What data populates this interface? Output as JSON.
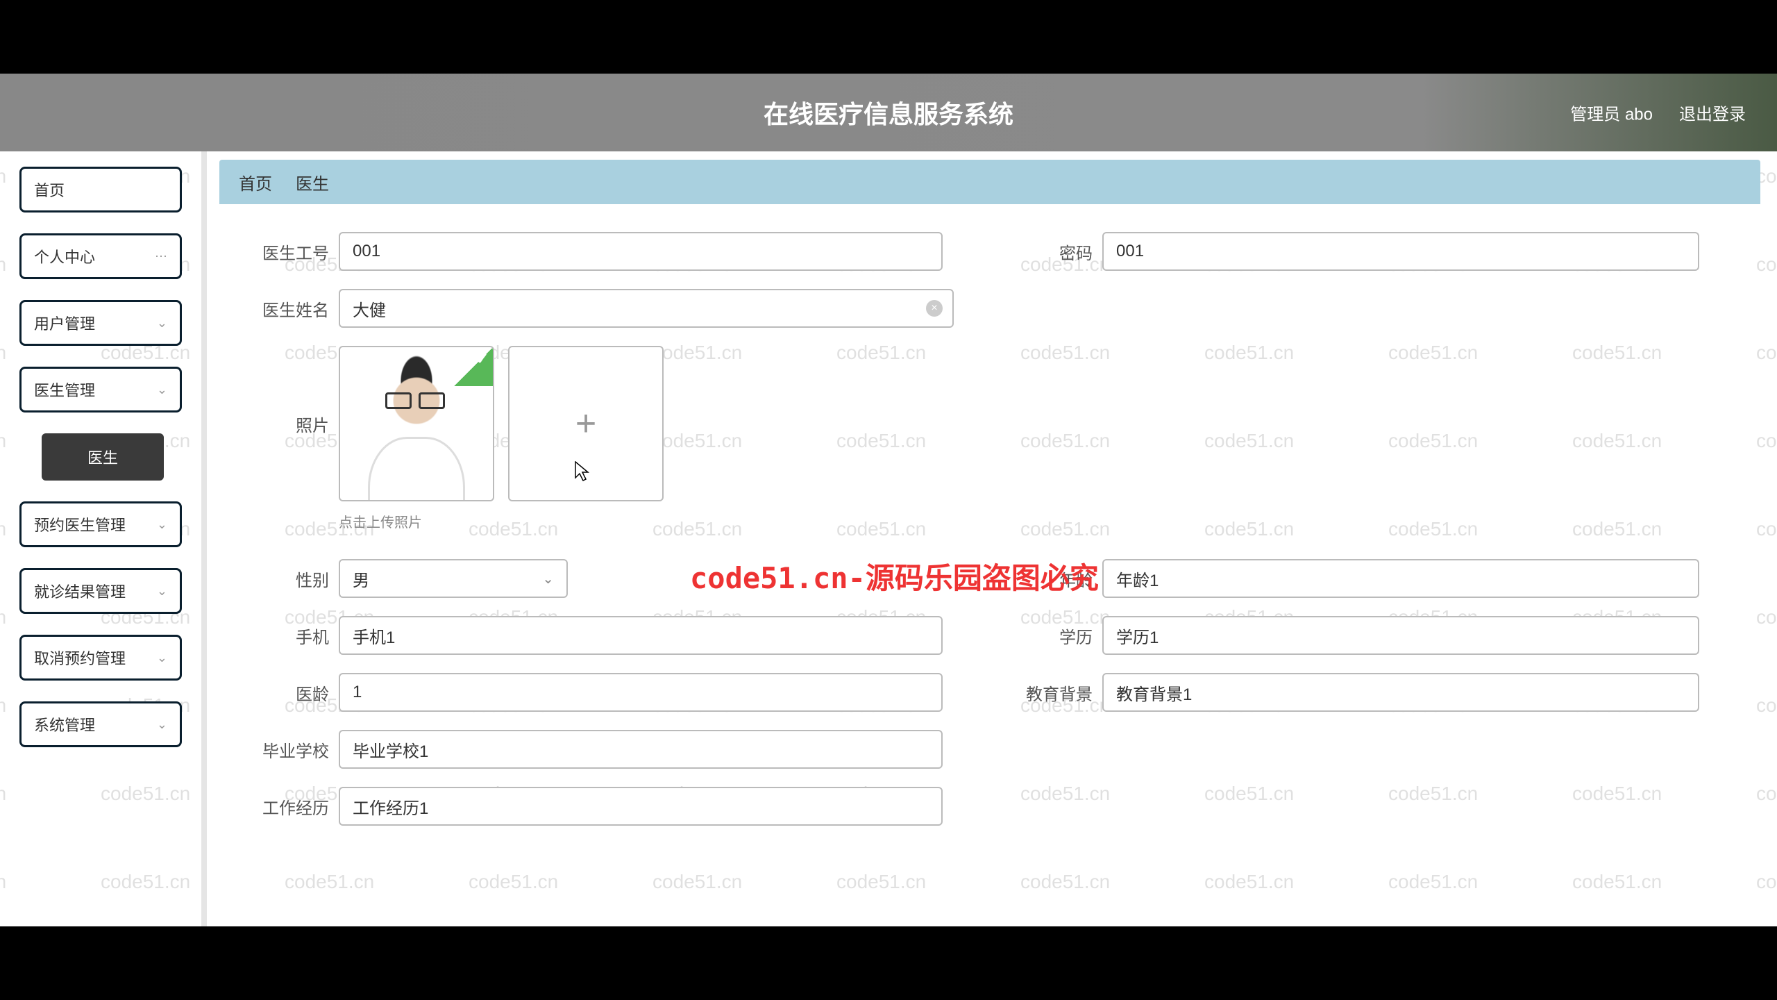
{
  "header": {
    "title": "在线医疗信息服务系统",
    "user": "管理员 abo",
    "logout": "退出登录"
  },
  "sidebar": {
    "items": [
      {
        "label": "首页"
      },
      {
        "label": "个人中心"
      },
      {
        "label": "用户管理"
      },
      {
        "label": "医生管理"
      },
      {
        "label": "医生",
        "submenu": true
      },
      {
        "label": "预约医生管理"
      },
      {
        "label": "就诊结果管理"
      },
      {
        "label": "取消预约管理"
      },
      {
        "label": "系统管理"
      }
    ]
  },
  "tabs": {
    "home": "首页",
    "current": "医生"
  },
  "form": {
    "doctor_id": {
      "label": "医生工号",
      "value": "001"
    },
    "password": {
      "label": "密码",
      "value": "001"
    },
    "doctor_name": {
      "label": "医生姓名",
      "value": "大健"
    },
    "photo": {
      "label": "照片",
      "hint": "点击上传照片"
    },
    "gender": {
      "label": "性别",
      "value": "男"
    },
    "age": {
      "label": "年龄",
      "value": "年龄1"
    },
    "phone": {
      "label": "手机",
      "value": "手机1"
    },
    "education": {
      "label": "学历",
      "value": "学历1"
    },
    "years": {
      "label": "医龄",
      "value": "1"
    },
    "edu_bg": {
      "label": "教育背景",
      "value": "教育背景1"
    },
    "school": {
      "label": "毕业学校",
      "value": "毕业学校1"
    },
    "work": {
      "label": "工作经历",
      "value": "工作经历1"
    }
  },
  "watermark": {
    "repeat": "code51.cn",
    "red": "code51.cn-源码乐园盗图必究"
  }
}
